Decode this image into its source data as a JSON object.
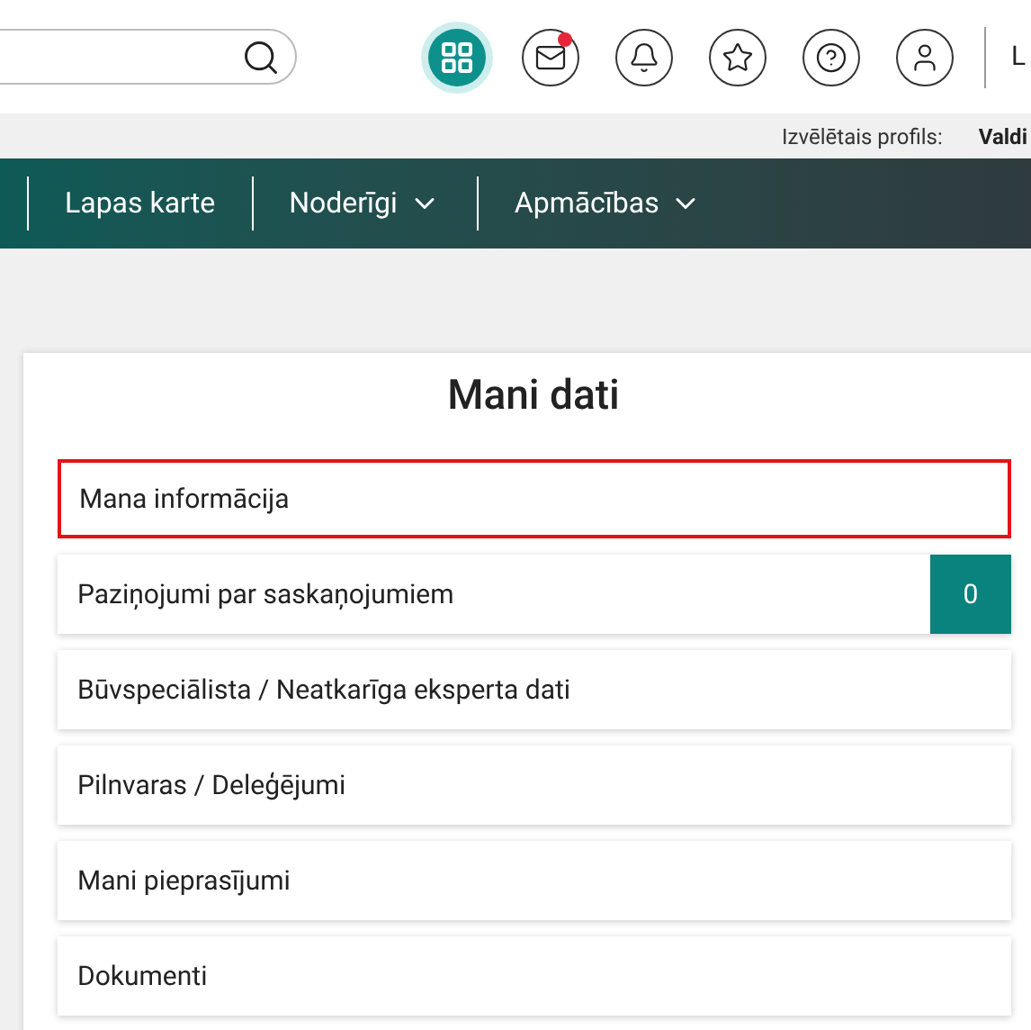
{
  "header": {
    "icons": [
      {
        "kind": "apps",
        "selected": true,
        "unread": false
      },
      {
        "kind": "mail",
        "selected": false,
        "unread": true
      },
      {
        "kind": "bell",
        "selected": false,
        "unread": false
      },
      {
        "kind": "star",
        "selected": false,
        "unread": false
      },
      {
        "kind": "help",
        "selected": false,
        "unread": false
      },
      {
        "kind": "user",
        "selected": false,
        "unread": false
      }
    ],
    "user_label": "L"
  },
  "profile_bar": {
    "label": "Izvēlētais profils:",
    "value": "Valdi"
  },
  "nav": [
    {
      "label": "Lapas karte",
      "dropdown": false
    },
    {
      "label": "Noderīgi",
      "dropdown": true
    },
    {
      "label": "Apmācības",
      "dropdown": true
    }
  ],
  "card": {
    "title": "Mani dati",
    "items": [
      {
        "label": "Mana informācija",
        "selected": true
      },
      {
        "label": "Paziņojumi par saskaņojumiem",
        "selected": false,
        "badge": "0"
      },
      {
        "label": "Būvspeciālista / Neatkarīga eksperta dati",
        "selected": false
      },
      {
        "label": "Pilnvaras / Deleģējumi",
        "selected": false
      },
      {
        "label": "Mani pieprasījumi",
        "selected": false
      },
      {
        "label": "Dokumenti",
        "selected": false
      }
    ]
  }
}
